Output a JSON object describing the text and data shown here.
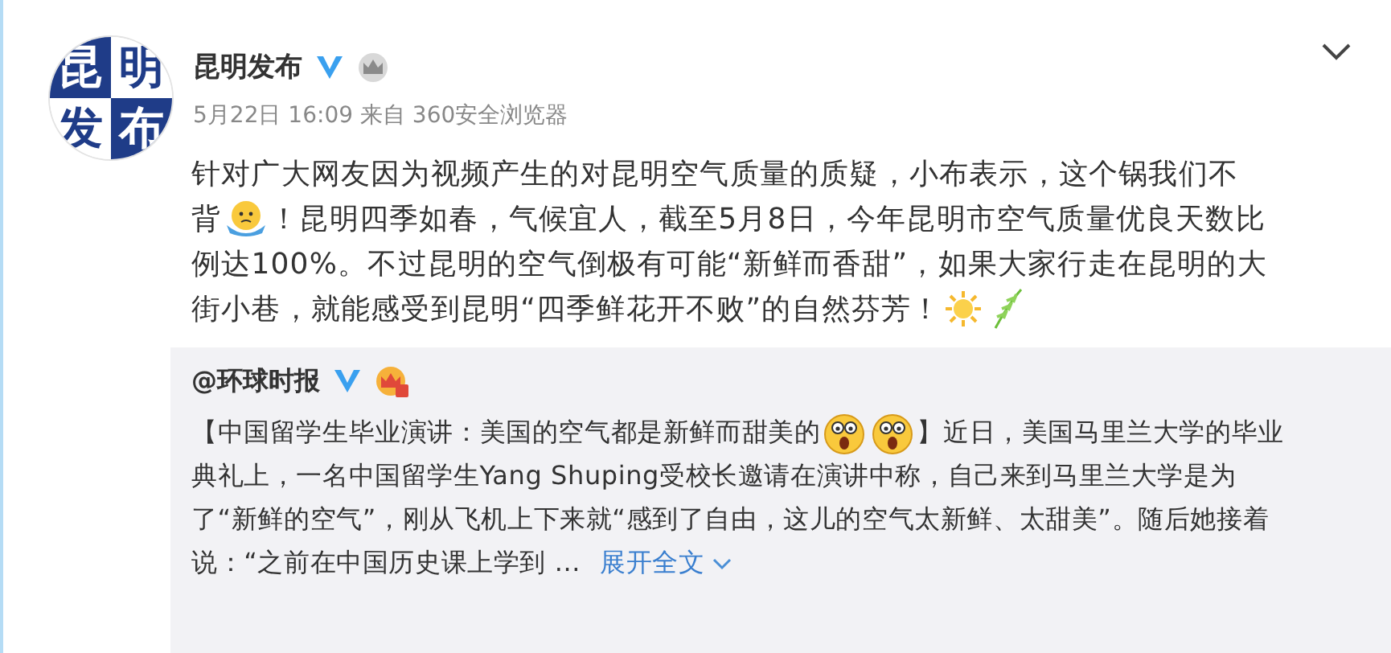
{
  "post": {
    "avatar_logo": [
      "昆",
      "明",
      "发",
      "布"
    ],
    "author": "昆明发布",
    "verified": true,
    "meta": "5月22日 16:09 来自 360安全浏览器",
    "lines": [
      [
        {
          "kind": "text",
          "text": "针对广大网友因为视频产生的对昆明空气质量的质疑，小布表示，这个锅我们不"
        }
      ],
      [
        {
          "kind": "text",
          "text": "背"
        },
        {
          "kind": "shrug"
        },
        {
          "kind": "text",
          "text": "！昆明四季如春，气候宜人，截至5月8日，今年昆明市空气质量优良天数比"
        }
      ],
      [
        {
          "kind": "text",
          "text": "例达100%。不过昆明的空气倒极有可能“新鲜而香甜”，如果大家行走在昆明的大"
        }
      ],
      [
        {
          "kind": "text",
          "text": "街小巷，就能感受到昆明“四季鲜花开不败”的自然芬芳！"
        },
        {
          "kind": "sun"
        },
        {
          "kind": "willow"
        }
      ]
    ]
  },
  "repost": {
    "author": "@环球时报",
    "verified": true,
    "lines": [
      [
        {
          "kind": "text",
          "text": "【中国留学生毕业演讲：美国的空气都是新鲜而甜美的"
        },
        {
          "kind": "shock"
        },
        {
          "kind": "shock"
        },
        {
          "kind": "text",
          "text": "】近日，美国马里兰大学的毕业"
        }
      ],
      [
        {
          "kind": "text",
          "text": "典礼上，一名中国留学生Yang Shuping受校长邀请在演讲中称，自己来到马里兰大学是为"
        }
      ],
      [
        {
          "kind": "text",
          "text": "了“新鲜的空气”，刚从飞机上下来就“感到了自由，这儿的空气太新鲜、太甜美”。随后她接着"
        }
      ],
      [
        {
          "kind": "text",
          "text": "说：“之前在中国历史课上学到 ..."
        },
        {
          "kind": "link"
        }
      ]
    ],
    "expand_link": "展开全文"
  }
}
